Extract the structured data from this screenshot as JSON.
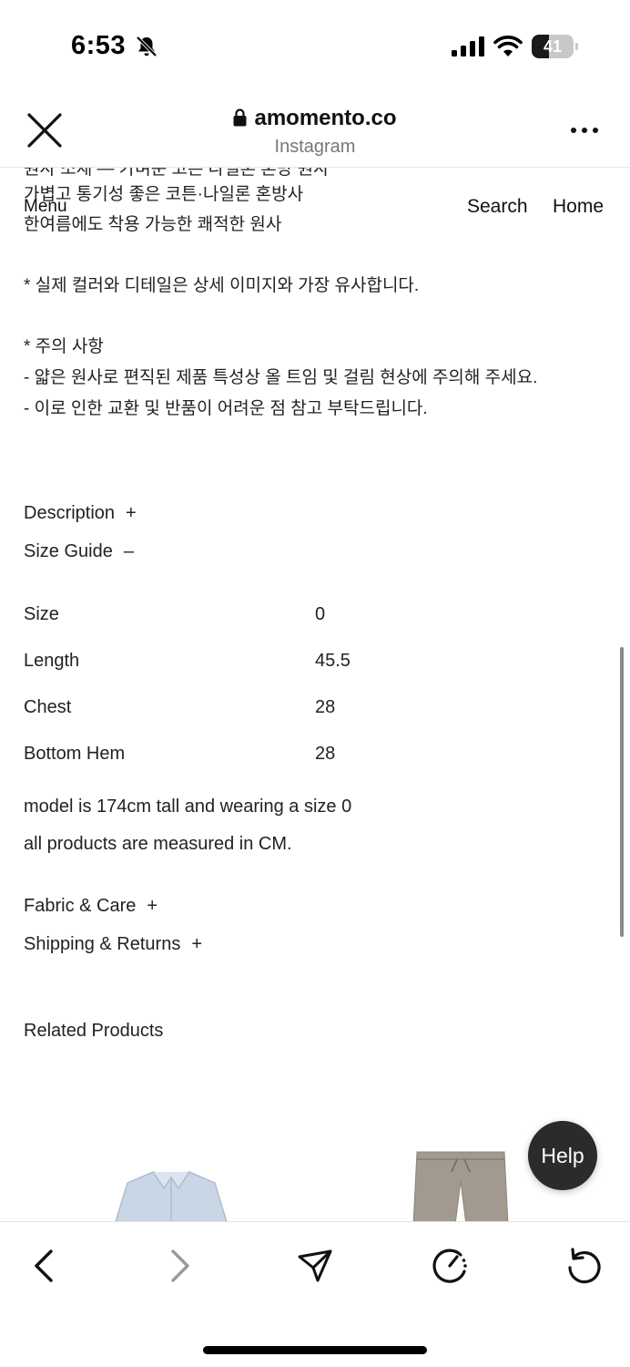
{
  "status_bar": {
    "time": "6:53",
    "battery_level": "41",
    "battery_fraction": 0.41
  },
  "browser": {
    "url": "amomento.co",
    "subtitle": "Instagram"
  },
  "site_nav": {
    "menu_label": "Menu",
    "search_label": "Search",
    "home_label": "Home"
  },
  "description": {
    "partial_top_line": "원사 소재 — 가벼운 코튼 나일론 혼방 원사",
    "lines": [
      "가볍고 통기성 좋은 코튼·나일론 혼방사",
      "한여름에도 착용 가능한 쾌적한 원사",
      "* 실제 컬러와 디테일은 상세 이미지와 가장 유사합니다.",
      "* 주의 사항",
      "- 얇은 원사로 편직된 제품 특성상 올 트임 및 걸림 현상에 주의해 주세요.",
      "- 이로 인한 교환 및 반품이 어려운 점 참고 부탁드립니다."
    ]
  },
  "accordions": {
    "description": {
      "label": "Description",
      "sign": "+"
    },
    "size_guide": {
      "label": "Size Guide",
      "sign": "–"
    },
    "fabric_care": {
      "label": "Fabric & Care",
      "sign": "+"
    },
    "shipping_returns": {
      "label": "Shipping & Returns",
      "sign": "+"
    }
  },
  "size_table": {
    "rows": [
      {
        "label": "Size",
        "value": "0"
      },
      {
        "label": "Length",
        "value": "45.5"
      },
      {
        "label": "Chest",
        "value": "28"
      },
      {
        "label": "Bottom Hem",
        "value": "28"
      }
    ],
    "notes": [
      "model is 174cm tall and wearing a size 0",
      "all products are measured in CM."
    ]
  },
  "related": {
    "title": "Related Products"
  },
  "help": {
    "label": "Help"
  },
  "colors": {
    "help_bg": "#2b2b2b",
    "shirt": "#c9d6e6",
    "pants": "#a39a8f"
  },
  "toolbar_icons": [
    "back-icon",
    "forward-icon",
    "share-icon",
    "speed-icon",
    "reload-icon"
  ]
}
